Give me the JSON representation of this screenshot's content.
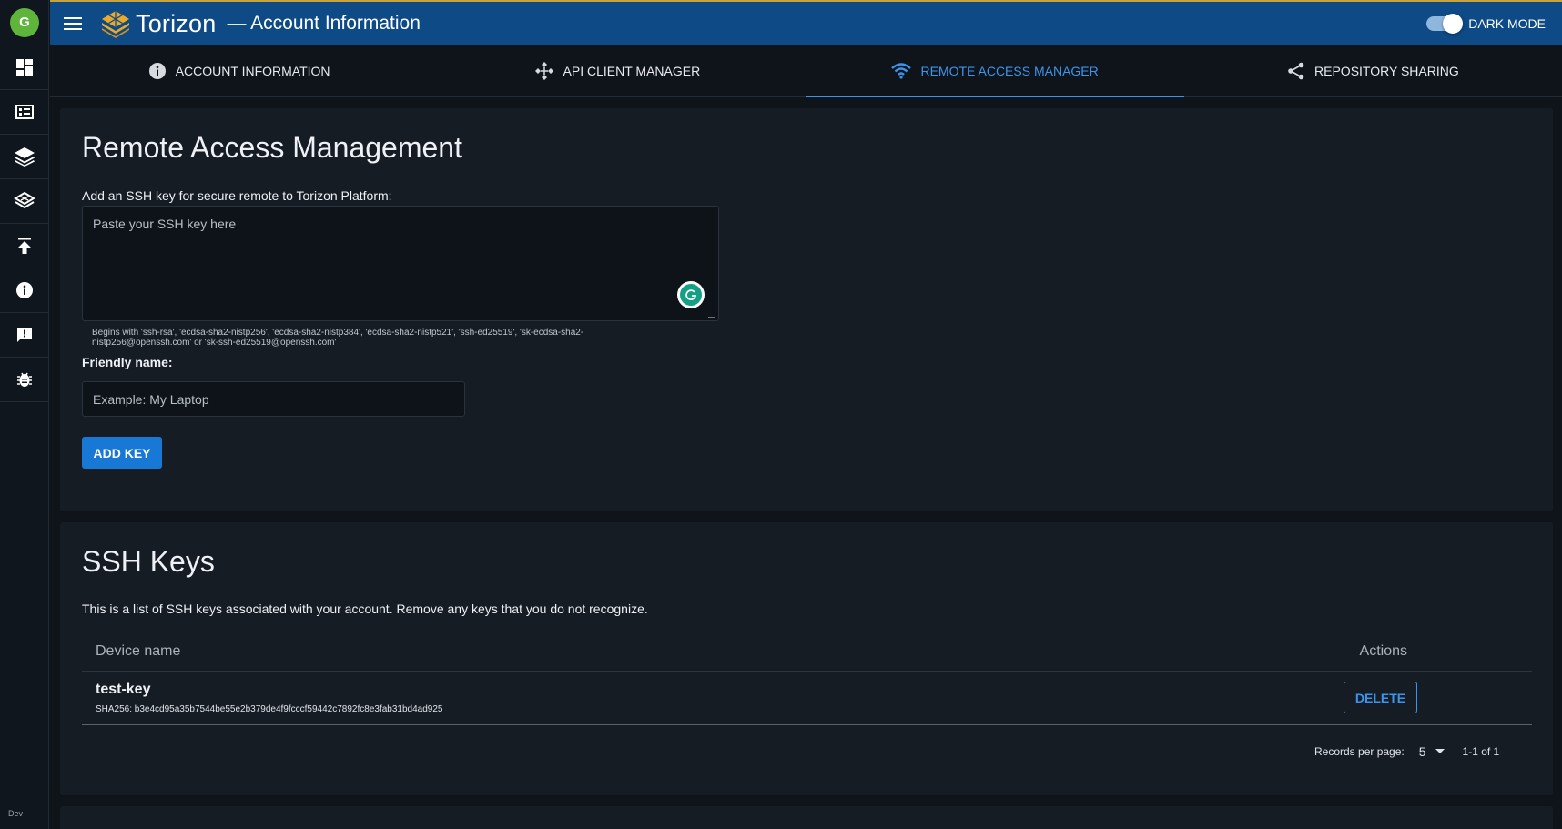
{
  "app": {
    "brand": "Torizon",
    "page_title": "— Account Information",
    "dark_mode_label": "DARK MODE",
    "avatar_initial": "G",
    "env_label": "Dev"
  },
  "sidebar": {
    "items": [
      {
        "name": "dashboard-icon"
      },
      {
        "name": "devices-icon"
      },
      {
        "name": "packages-icon"
      },
      {
        "name": "repositories-icon"
      },
      {
        "name": "upload-icon"
      },
      {
        "name": "info-icon"
      },
      {
        "name": "feedback-icon"
      },
      {
        "name": "bug-icon"
      }
    ]
  },
  "tabs": [
    {
      "label": "ACCOUNT INFORMATION",
      "icon": "info-icon",
      "active": false
    },
    {
      "label": "API CLIENT MANAGER",
      "icon": "api-icon",
      "active": false
    },
    {
      "label": "REMOTE ACCESS MANAGER",
      "icon": "wifi-icon",
      "active": true
    },
    {
      "label": "REPOSITORY SHARING",
      "icon": "share-icon",
      "active": false
    }
  ],
  "remote_access": {
    "title": "Remote Access Management",
    "ssh_label": "Add an SSH key for secure remote to Torizon Platform:",
    "ssh_placeholder": "Paste your SSH key here",
    "hint": "Begins with 'ssh-rsa', 'ecdsa-sha2-nistp256', 'ecdsa-sha2-nistp384', 'ecdsa-sha2-nistp521', 'ssh-ed25519', 'sk-ecdsa-sha2-nistp256@openssh.com' or 'sk-ssh-ed25519@openssh.com'",
    "friendly_label": "Friendly name:",
    "friendly_placeholder": "Example: My Laptop",
    "add_button": "ADD KEY"
  },
  "ssh_keys": {
    "title": "SSH Keys",
    "description": "This is a list of SSH keys associated with your account. Remove any keys that you do not recognize.",
    "columns": {
      "name": "Device name",
      "actions": "Actions"
    },
    "rows": [
      {
        "name": "test-key",
        "hash": "SHA256: b3e4cd95a35b7544be55e2b379de4f9fcccf59442c7892fc8e3fab31bd4ad925",
        "action": "DELETE"
      }
    ],
    "pagination": {
      "label": "Records per page:",
      "per_page": "5",
      "range": "1-1 of 1"
    }
  }
}
